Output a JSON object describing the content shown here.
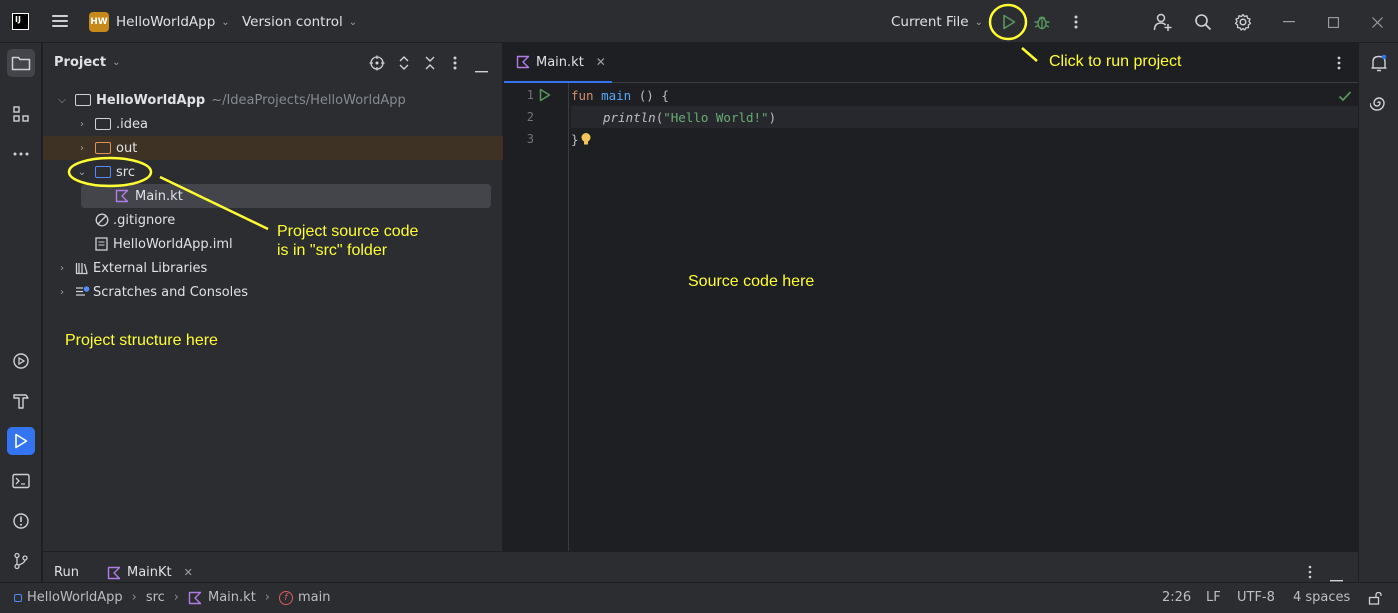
{
  "titlebar": {
    "app_logo": "IJ",
    "project_badge": "HW",
    "project_name": "HelloWorldApp",
    "vcs_label": "Version control",
    "run_config": "Current File"
  },
  "project_panel": {
    "title": "Project",
    "tree": {
      "root_name": "HelloWorldApp",
      "root_path": "~/IdeaProjects/HelloWorldApp",
      "idea": ".idea",
      "out": "out",
      "src": "src",
      "main_kt": "Main.kt",
      "gitignore": ".gitignore",
      "iml": "HelloWorldApp.iml",
      "ext_libs": "External Libraries",
      "scratches": "Scratches and Consoles"
    }
  },
  "editor": {
    "tab_label": "Main.kt",
    "line_numbers": [
      "1",
      "2",
      "3"
    ],
    "code": {
      "l1_kw": "fun",
      "l1_fn": "main",
      "l1_rest": " () {",
      "l2_fn": "println",
      "l2_open": "(",
      "l2_str": "\"Hello World!\"",
      "l2_close": ")",
      "l3": "}"
    }
  },
  "run_panel": {
    "title": "Run",
    "tab_label": "MainKt"
  },
  "statusbar": {
    "crumb_project": "HelloWorldApp",
    "crumb_src": "src",
    "crumb_file": "Main.kt",
    "crumb_fn": "main",
    "position": "2:26",
    "line_sep": "LF",
    "encoding": "UTF-8",
    "indent": "4 spaces"
  },
  "annotations": {
    "run": "Click to run project",
    "src_line1": "Project source code",
    "src_line2": "is in \"src\" folder",
    "source": "Source code here",
    "structure": "Project structure here"
  },
  "colors": {
    "accent": "#3574f0",
    "annotation": "#ffff33",
    "run_green": "#57965c"
  }
}
